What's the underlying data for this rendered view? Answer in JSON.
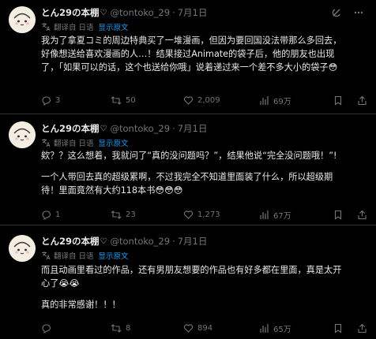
{
  "tweets": [
    {
      "author": {
        "name": "とん29の本棚",
        "badge": "♡",
        "handle": "@tontoko_29",
        "separator": "·",
        "date": "7月1日"
      },
      "translation": {
        "label": "翻译自 日语",
        "show_original": "显示原文"
      },
      "paragraphs": [
        [
          "我为了拿夏コミ的周边特典买了一堆漫画，但因为要回国没法带那么多回去，",
          "好像想送给喜欢漫画的人…！结果接过Animate的袋子后，他的朋友也出现",
          "了，「如果可以的话，这个也送给你哦」说着递过来一个差不多大小的袋子😳"
        ]
      ],
      "stats": {
        "replies": "3",
        "retweets": "50",
        "likes": "2,009",
        "views": "69万"
      }
    },
    {
      "author": {
        "name": "とん29の本棚",
        "badge": "♡",
        "handle": "@tontoko_29",
        "separator": "·",
        "date": "7月1日"
      },
      "translation": {
        "label": "翻译自 日语",
        "show_original": "显示原文"
      },
      "paragraphs": [
        [
          "欸？？这么想着，我就问了“真的没问题吗？”，结果他说“完全没问题哦！”!"
        ],
        [
          "一个人带回去真的超级累啊，不过我完全不知道里面装了什么，所以超级期",
          "待！里面竟然有大约118本书😳😳😳"
        ]
      ],
      "stats": {
        "replies": "1",
        "retweets": "23",
        "likes": "1,273",
        "views": "67万"
      }
    },
    {
      "author": {
        "name": "とん29の本棚",
        "badge": "♡",
        "handle": "@tontoko_29",
        "separator": "·",
        "date": "7月1日"
      },
      "translation": {
        "label": "翻译自 日语",
        "show_original": "显示原文"
      },
      "paragraphs": [
        [
          "而且动画里看过的作品，还有男朋友想要的作品也有好多都在里面，真是太开",
          "心了😭😭"
        ],
        [
          "真的非常感谢！！！"
        ]
      ],
      "stats": {
        "replies": "",
        "retweets": "8",
        "likes": "894",
        "views": "65万"
      }
    }
  ],
  "icons": {
    "avatar": "cartoon-face-avatar",
    "grok": "grok-icon",
    "more": "more-icon",
    "translate": "translate-icon",
    "reply": "reply-icon",
    "retweet": "retweet-icon",
    "like": "heart-icon",
    "views": "views-icon",
    "bookmark": "bookmark-icon",
    "share": "share-icon"
  },
  "colors": {
    "background": "#000000",
    "text": "#e7e9ea",
    "muted": "#71767b",
    "link": "#1d9bf0",
    "divider": "#2f3336"
  }
}
